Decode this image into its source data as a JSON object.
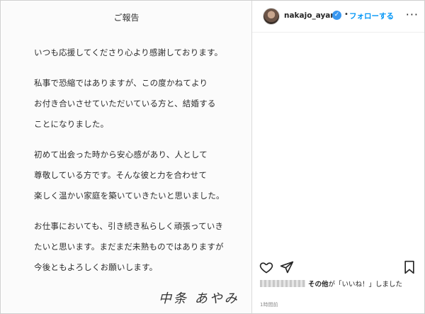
{
  "letter": {
    "title": "ご報告",
    "lines": [
      "いつも応援してくださり心より感謝しております。",
      "私事で恐縮ではありますが、この度かねてより",
      "お付き合いさせていただいている方と、結婚する",
      "ことになりました。",
      "初めて出会った時から安心感があり、人として",
      "尊敬している方です。そんな彼と力を合わせて",
      "楽しく温かい家庭を築いていきたいと思いました。",
      "お仕事においても、引き続き私らしく頑張っていき",
      "たいと思います。まだまだ未熟ものではありますが",
      "今後ともよろしくお願いします。"
    ],
    "signature": "中条 あやみ"
  },
  "header": {
    "username": "nakajo_ayami",
    "verified_mark": "✓",
    "separator": "•",
    "follow_label": "フォローする",
    "more_glyph": "···"
  },
  "likes": {
    "others_label": "その他",
    "text": "が「いいね！」しました"
  },
  "timestamp": "1時間前",
  "icons": [
    "heart-icon",
    "share-icon",
    "bookmark-icon",
    "verified-badge-icon",
    "more-options-icon"
  ],
  "colors": {
    "accent": "#0095f6",
    "verified": "#3897f0",
    "text": "#262626",
    "muted": "#8e8e8e"
  }
}
